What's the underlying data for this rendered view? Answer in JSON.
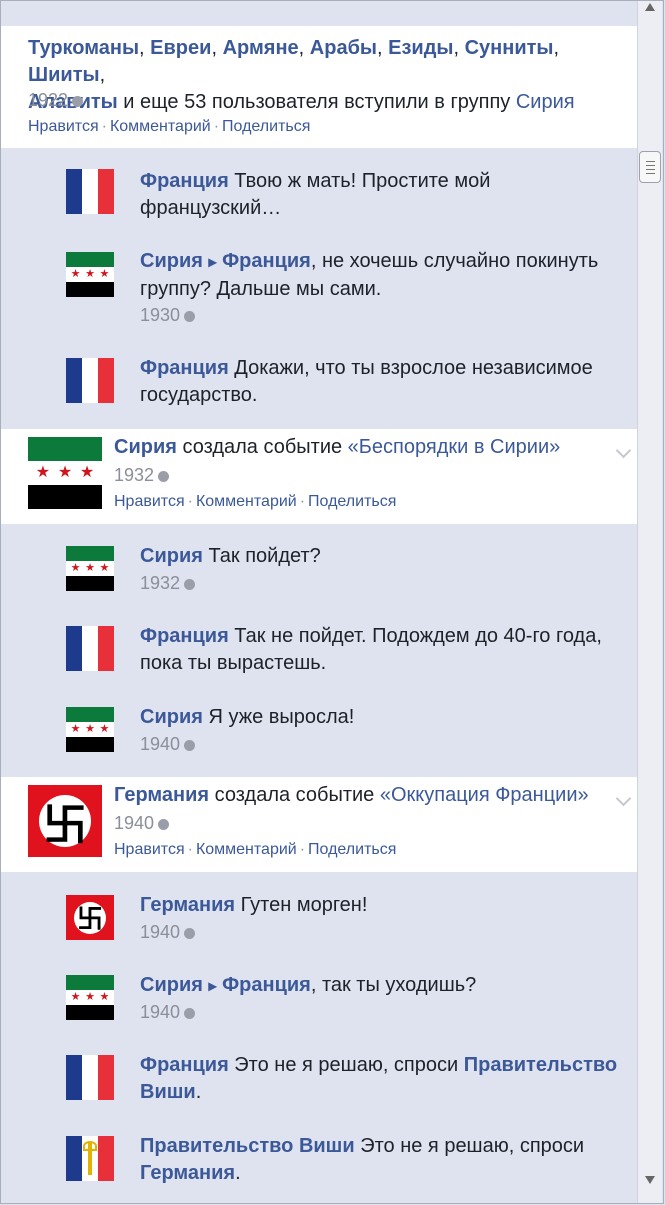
{
  "scrollbar": {
    "thumb_icon": "grip-lines-icon"
  },
  "post1": {
    "members": [
      "Туркоманы",
      "Евреи",
      "Армяне",
      "Арабы",
      "Езиды",
      "Сунниты",
      "Шииты",
      "Алавиты"
    ],
    "sep": ", ",
    "joined_text": " и еще 53 пользователя вступили в группу ",
    "group": "Сирия",
    "year": "1922",
    "globe_icon": "globe-icon"
  },
  "actions": {
    "like": "Нравится",
    "comment": "Комментарий",
    "share": "Поделиться",
    "dot": "·"
  },
  "replies1": [
    {
      "name": "Франция",
      "text": " Твою ж мать! Простите мой",
      "text2": "французский…",
      "flag": "france-flag"
    },
    {
      "name": "Сирия",
      "arrow": "▸",
      "target": "Франция",
      "text": ", не хочешь случайно покинуть",
      "text2": "группу? Дальше мы сами.",
      "year": "1930",
      "flag": "syria-flag"
    },
    {
      "name": "Франция",
      "text": " Докажи, что ты взрослое независимое",
      "text2": "государство.",
      "flag": "france-flag"
    }
  ],
  "post2": {
    "name": "Сирия",
    "text": " создала событие ",
    "event": "«Беспорядки в Сирии»",
    "year": "1932",
    "flag": "syria-flag"
  },
  "replies2": [
    {
      "name": "Сирия",
      "text": " Так пойдет?",
      "year": "1932",
      "flag": "syria-flag"
    },
    {
      "name": "Франция",
      "text": " Так не пойдет. Подождем до 40-го года,",
      "text2": "пока ты вырастешь.",
      "flag": "france-flag"
    },
    {
      "name": "Сирия",
      "text": " Я уже выросла!",
      "year": "1940",
      "flag": "syria-flag"
    }
  ],
  "post3": {
    "name": "Германия",
    "text": " создала событие ",
    "event": "«Оккупация Франции»",
    "year": "1940",
    "flag": "germany-flag"
  },
  "replies3": [
    {
      "name": "Германия",
      "text": " Гутен морген!",
      "year": "1940",
      "flag": "germany-flag"
    },
    {
      "name": "Сирия",
      "arrow": "▸",
      "target": "Франция",
      "text": ", так ты уходишь?",
      "year": "1940",
      "flag": "syria-flag"
    },
    {
      "name": "Франция",
      "text": " Это не я решаю, спроси ",
      "link": "Правительство",
      "link2": "Виши",
      "end": ".",
      "flag": "france-flag"
    },
    {
      "name": "Правительство Виши",
      "text": " Это не я решаю, спроси",
      "link": "Германия",
      "end": ".",
      "flag": "vichy-flag"
    }
  ],
  "colors": {
    "link": "#3b5998",
    "muted": "#8a8f99",
    "bg": "#dfe2ef"
  }
}
